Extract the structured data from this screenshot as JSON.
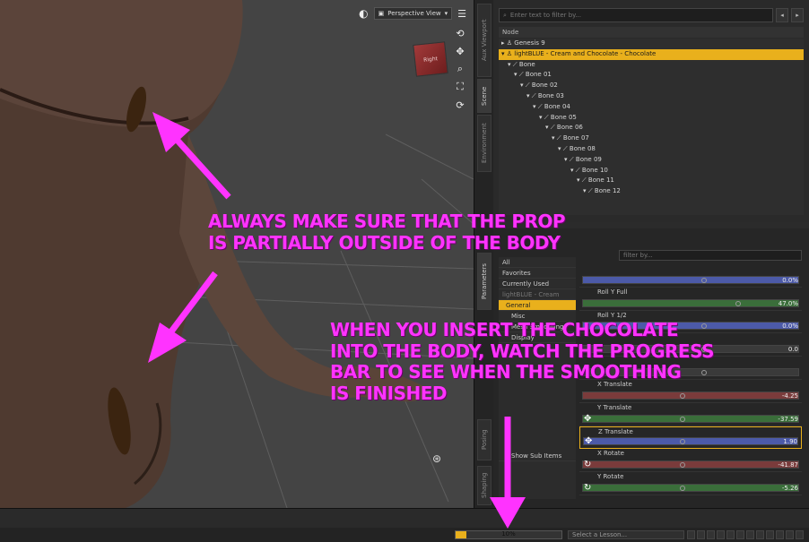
{
  "viewport": {
    "view_selector": "Perspective View",
    "cube_label": "Right",
    "side_tabs": [
      "Aux Viewport",
      "Scene",
      "Environment",
      "Parameters",
      "Posing",
      "Shaping"
    ]
  },
  "scene": {
    "filter_placeholder": "Enter text to filter by...",
    "column_header": "Node",
    "tree": [
      {
        "label": "Genesis 9",
        "indent": 0,
        "prefix": "▸"
      },
      {
        "label": "lightBLUE - Cream and Chocolate - Chocolate",
        "indent": 0,
        "prefix": "▾",
        "selected": true
      },
      {
        "label": "Bone",
        "indent": 1,
        "prefix": "▾"
      },
      {
        "label": "Bone 01",
        "indent": 2,
        "prefix": "▾"
      },
      {
        "label": "Bone 02",
        "indent": 3,
        "prefix": "▾"
      },
      {
        "label": "Bone 03",
        "indent": 4,
        "prefix": "▾"
      },
      {
        "label": "Bone 04",
        "indent": 5,
        "prefix": "▾"
      },
      {
        "label": "Bone 05",
        "indent": 6,
        "prefix": "▾"
      },
      {
        "label": "Bone 06",
        "indent": 7,
        "prefix": "▾"
      },
      {
        "label": "Bone 07",
        "indent": 8,
        "prefix": "▾"
      },
      {
        "label": "Bone 08",
        "indent": 9,
        "prefix": "▾"
      },
      {
        "label": "Bone 09",
        "indent": 10,
        "prefix": "▾"
      },
      {
        "label": "Bone 10",
        "indent": 11,
        "prefix": "▾"
      },
      {
        "label": "Bone 11",
        "indent": 12,
        "prefix": "▾"
      },
      {
        "label": "Bone 12",
        "indent": 13,
        "prefix": "▾"
      }
    ]
  },
  "parameters": {
    "filter_placeholder": "filter by...",
    "groups": [
      {
        "label": "All"
      },
      {
        "label": "Favorites"
      },
      {
        "label": "Currently Used"
      },
      {
        "label": "lightBLUE - Cream",
        "dim": true
      },
      {
        "label": "General",
        "selected": true
      },
      {
        "label": "Misc"
      },
      {
        "label": "Mesh Smoothing"
      },
      {
        "label": "Display"
      },
      {
        "label": "Show Sub Items"
      }
    ],
    "sliders": [
      {
        "label": "",
        "value": "0.0%",
        "color": "#4c5aa8",
        "knob": 0.55,
        "icon": ""
      },
      {
        "label": "Roll Y Full",
        "value": "47.0%",
        "color": "#3a6e3a",
        "knob": 0.7,
        "icon": ""
      },
      {
        "label": "Roll Y 1/2",
        "value": "0.0%",
        "color": "#4c5aa8",
        "knob": 0.55,
        "icon": ""
      },
      {
        "label": "",
        "value": "0.0",
        "color": "#3a3a3a",
        "knob": 0.55,
        "icon": ""
      },
      {
        "label": "",
        "value": "",
        "color": "#3a3a3a",
        "knob": 0.55,
        "icon": ""
      },
      {
        "label": "X Translate",
        "value": "-4.25",
        "color": "#7a3b3b",
        "knob": 0.45,
        "icon": ""
      },
      {
        "label": "Y Translate",
        "value": "-37.59",
        "color": "#3a6e3a",
        "knob": 0.45,
        "icon": "✥"
      },
      {
        "label": "Z Translate",
        "value": "1.90",
        "color": "#4c5aa8",
        "knob": 0.45,
        "icon": "✥",
        "selected": true
      },
      {
        "label": "X Rotate",
        "value": "-41.87",
        "color": "#7a3b3b",
        "knob": 0.45,
        "icon": "↻"
      },
      {
        "label": "Y Rotate",
        "value": "-5.26",
        "color": "#3a6e3a",
        "knob": 0.45,
        "icon": "↻"
      }
    ]
  },
  "status": {
    "progress_text": "10%",
    "progress_value": 0.1,
    "lesson_placeholder": "Select a Lesson..."
  },
  "annotations": {
    "callout_1_line_1": "ALWAYS MAKE SURE THAT THE PROP",
    "callout_1_line_2": "IS PARTIALLY OUTSIDE OF THE BODY",
    "callout_2_line_1": "WHEN YOU INSERT THE CHOCOLATE",
    "callout_2_line_2": "INTO THE BODY, WATCH THE PROGRESS",
    "callout_2_line_3": "BAR TO SEE WHEN THE SMOOTHING",
    "callout_2_line_4": "IS FINISHED",
    "color": "#ff33ff"
  }
}
